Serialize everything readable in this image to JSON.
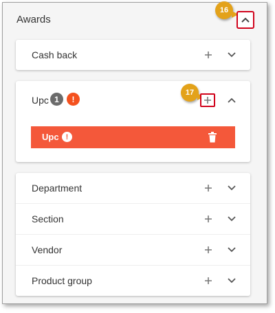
{
  "awards": {
    "title": "Awards",
    "callout_collapse": "16",
    "callout_add": "17"
  },
  "cards": {
    "cash_back": {
      "label": "Cash back"
    },
    "upc": {
      "label": "Upc",
      "count": "1",
      "alert": "!",
      "item": {
        "label": "Upc",
        "alert": "!"
      }
    },
    "groups": [
      {
        "label": "Department"
      },
      {
        "label": "Section"
      },
      {
        "label": "Vendor"
      },
      {
        "label": "Product group"
      }
    ]
  },
  "icons": {
    "plus": "plus-icon",
    "chevron_down": "chevron-down-icon",
    "chevron_up": "chevron-up-icon",
    "trash": "trash-icon",
    "alert": "alert-icon"
  },
  "colors": {
    "highlight": "#d0021b",
    "callout": "#e3a21a",
    "danger": "#f4583a",
    "count_badge": "#6b6b6b"
  }
}
